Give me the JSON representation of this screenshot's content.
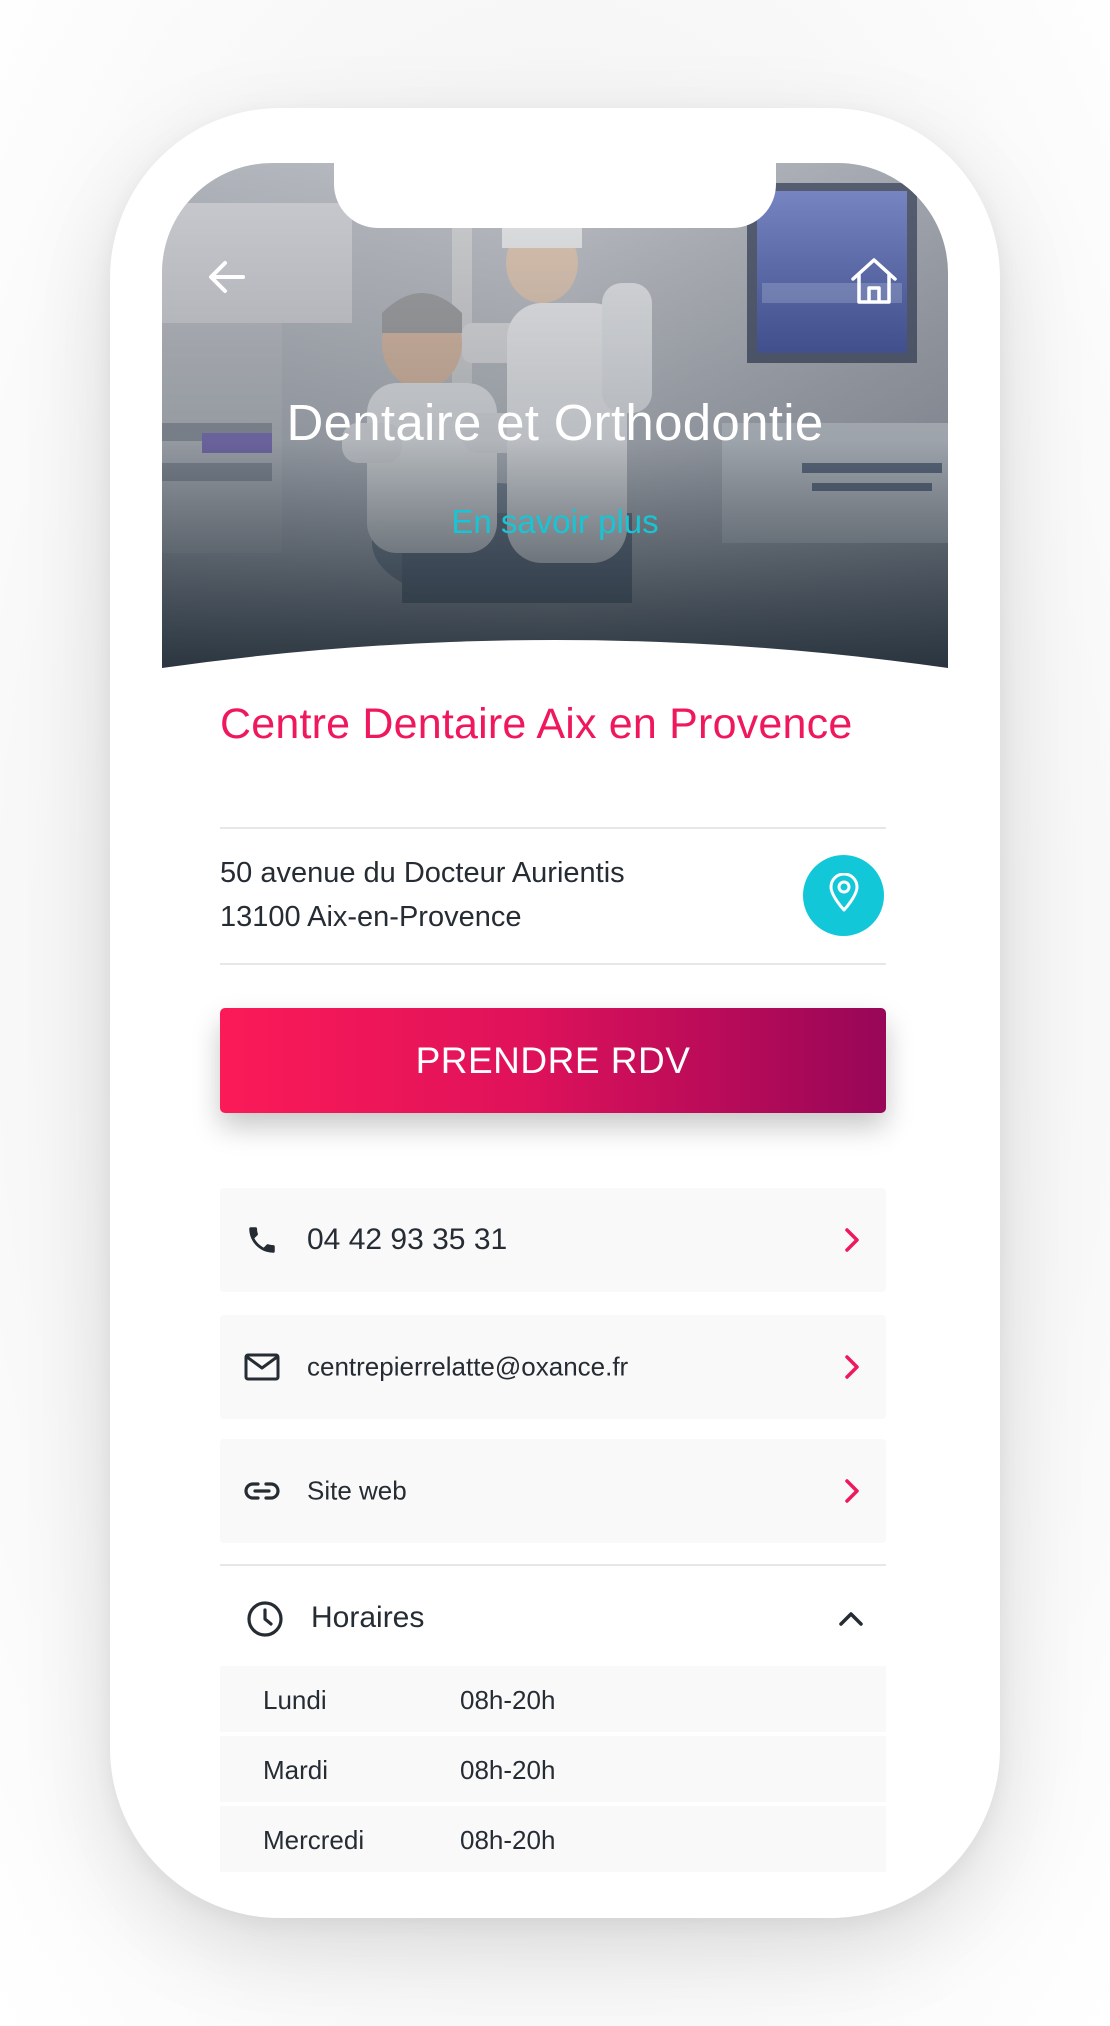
{
  "hero": {
    "title": "Dentaire et Orthodontie",
    "link_label": "En savoir plus",
    "back_icon": "arrow-left-icon",
    "home_icon": "home-icon"
  },
  "center": {
    "name": "Centre Dentaire Aix en Provence",
    "address_line1": "50 avenue du Docteur Aurientis",
    "address_line2": "13100 Aix-en-Provence",
    "map_icon": "map-pin-icon"
  },
  "cta": {
    "label": "PRENDRE RDV"
  },
  "contacts": {
    "phone": {
      "icon": "phone-icon",
      "label": "04 42 93 35 31"
    },
    "email": {
      "icon": "mail-icon",
      "label": "centrepierrelatte@oxance.fr"
    },
    "website": {
      "icon": "link-icon",
      "label": "Site web"
    }
  },
  "hours": {
    "icon": "clock-icon",
    "title": "Horaires",
    "rows": [
      {
        "day": "Lundi",
        "time": "08h-20h"
      },
      {
        "day": "Mardi",
        "time": "08h-20h"
      },
      {
        "day": "Mercredi",
        "time": "08h-20h"
      }
    ]
  },
  "colors": {
    "accent_pink": "#f0185c",
    "accent_cyan": "#19c4d4",
    "button_gradient_start": "#fb1a58",
    "button_gradient_end": "#980658",
    "text_dark": "#262c33"
  }
}
